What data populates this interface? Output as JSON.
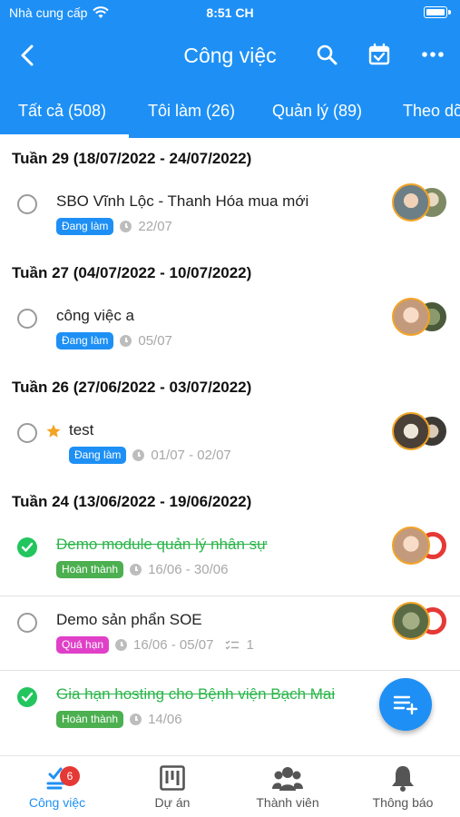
{
  "status_bar": {
    "carrier": "Nhà cung cấp",
    "time": "8:51 CH"
  },
  "nav": {
    "title": "Công việc"
  },
  "tabs": [
    {
      "label": "Tất cả (508)"
    },
    {
      "label": "Tôi làm (26)"
    },
    {
      "label": "Quản lý (89)"
    },
    {
      "label": "Theo dõ"
    }
  ],
  "weeks": [
    {
      "label": "Tuần 29 (18/07/2022 - 24/07/2022)"
    },
    {
      "label": "Tuần 27 (04/07/2022 - 10/07/2022)"
    },
    {
      "label": "Tuần 26 (27/06/2022 - 03/07/2022)"
    },
    {
      "label": "Tuần 24 (13/06/2022 - 19/06/2022)"
    }
  ],
  "tasks": [
    {
      "name": "SBO Vĩnh Lộc - Thanh Hóa mua mới",
      "status": "Đang làm",
      "date": "22/07",
      "done": false
    },
    {
      "name": "công việc a",
      "status": "Đang làm",
      "date": "05/07",
      "done": false
    },
    {
      "name": "test",
      "status": "Đang làm",
      "date": "01/07 - 02/07",
      "done": false,
      "starred": true
    },
    {
      "name": "Demo module quản lý nhân sự",
      "status": "Hoàn thành",
      "date": "16/06 - 30/06",
      "done": true
    },
    {
      "name": "Demo sản phẩn SOE",
      "status": "Quá hạn",
      "date": "16/06 - 05/07",
      "subtasks": "1",
      "done": false
    },
    {
      "name": "Gia hạn hosting cho Bệnh viện Bạch Mai",
      "status": "Hoàn thành",
      "date": "14/06",
      "done": true
    }
  ],
  "bottom_nav": [
    {
      "label": "Công việc",
      "badge": "6",
      "active": true
    },
    {
      "label": "Dự án"
    },
    {
      "label": "Thành viên"
    },
    {
      "label": "Thông báo"
    }
  ],
  "colors": {
    "primary": "#1e90f5",
    "done": "#22c55e",
    "overdue": "#e040c8",
    "star": "#f2a425"
  },
  "icons": [
    "back-icon",
    "search-icon",
    "calendar-check-icon",
    "more-icon",
    "clock-icon",
    "star-icon",
    "check-icon",
    "subtask-icon",
    "add-task-icon",
    "tasks-icon",
    "project-icon",
    "members-icon",
    "bell-icon"
  ]
}
